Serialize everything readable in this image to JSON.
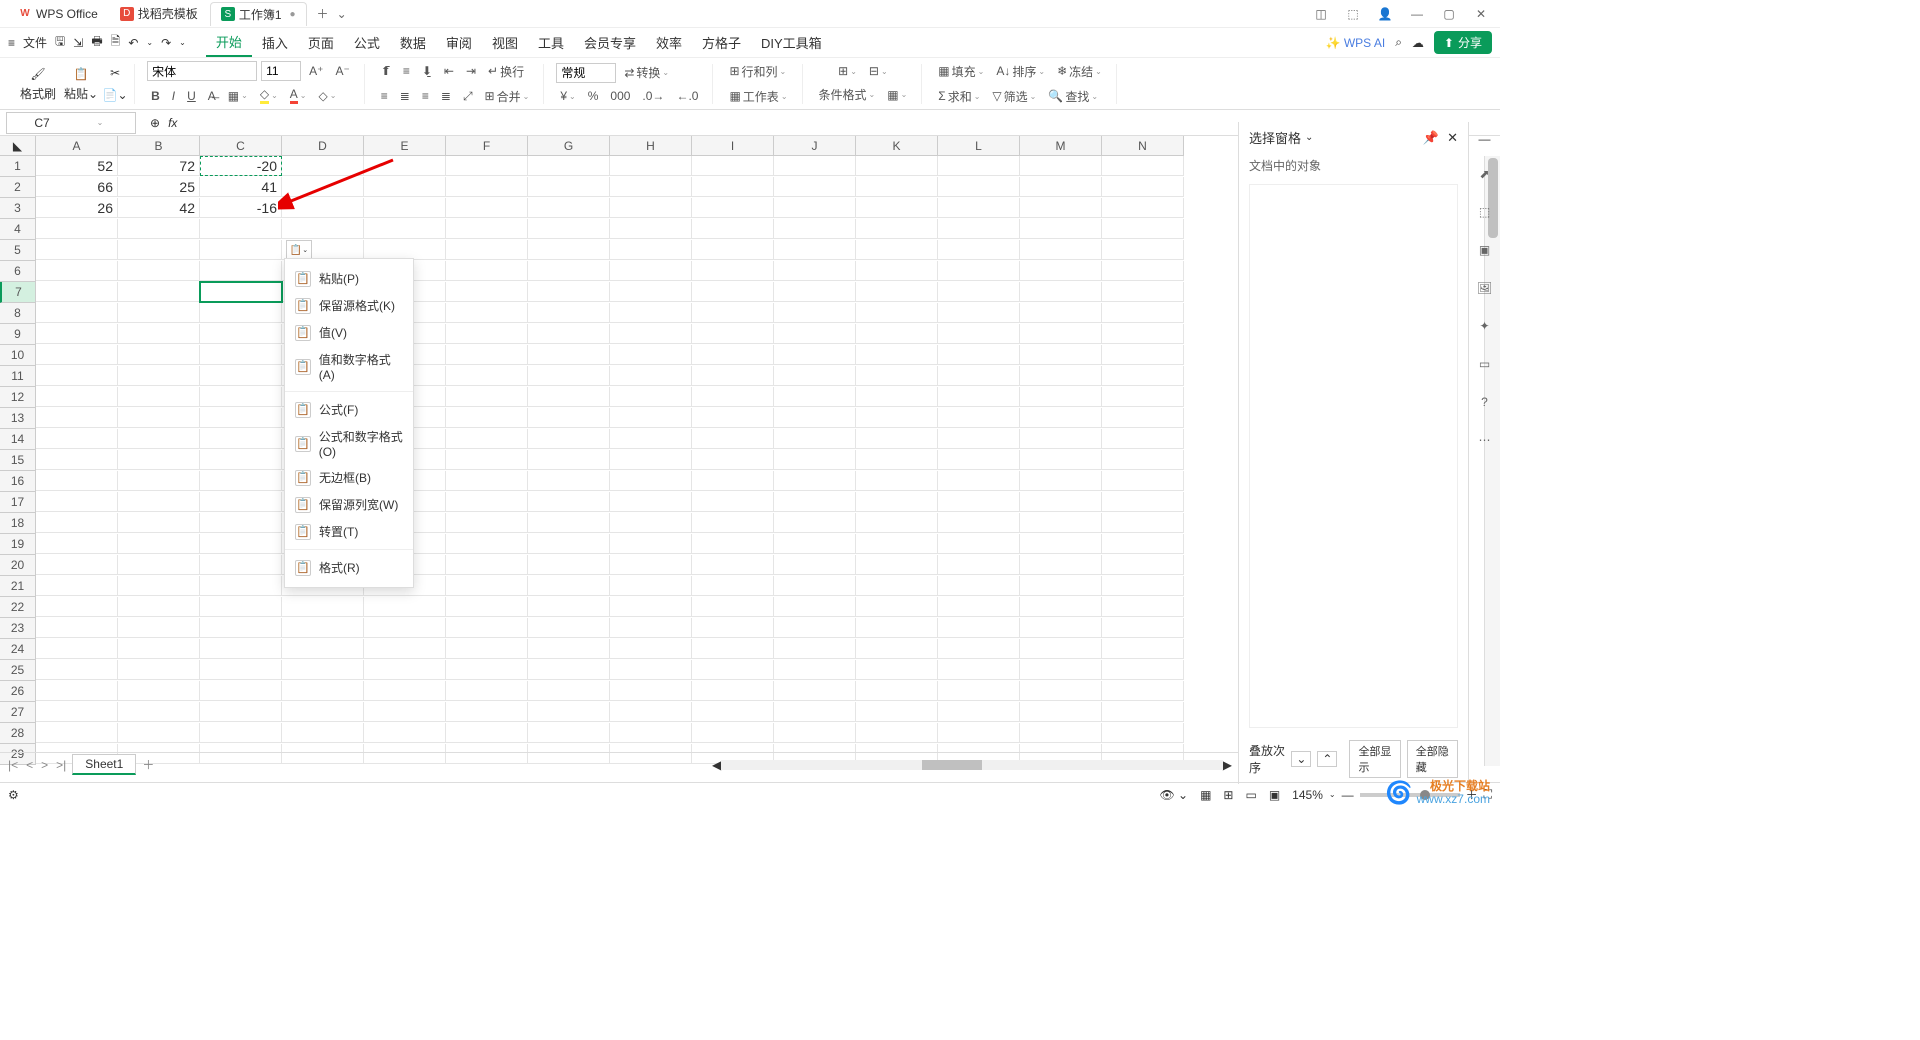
{
  "titlebar": {
    "tabs": [
      {
        "icon_color": "#e74c3c",
        "icon_text": "W",
        "label": "WPS Office"
      },
      {
        "icon_color": "#e74c3c",
        "icon_text": "D",
        "label": "找稻壳模板"
      },
      {
        "icon_color": "#0a9b5a",
        "icon_text": "S",
        "label": "工作簿1",
        "active": true,
        "dirty": "●"
      }
    ],
    "add": "＋",
    "dropdown": "⌄"
  },
  "menubar": {
    "menu": "≡",
    "file": "文件",
    "quick": [
      "save-icon",
      "print-icon",
      "print-preview-icon",
      "print-direct-icon",
      "undo-icon",
      "redo-icon",
      "dropdown-icon"
    ],
    "tabs": [
      "开始",
      "插入",
      "页面",
      "公式",
      "数据",
      "审阅",
      "视图",
      "工具",
      "会员专享",
      "效率",
      "方格子",
      "DIY工具箱"
    ],
    "active_tab": "开始",
    "ai": "WPS AI",
    "search": "⌕",
    "cloud": "☁",
    "share": "分享"
  },
  "ribbon": {
    "format_painter": "格式刷",
    "paste": "粘贴",
    "font": "宋体",
    "size": "11",
    "number_format": "常规",
    "convert": "转换",
    "row_col": "行和列",
    "worksheet": "工作表",
    "cond_format": "条件格式",
    "fill": "填充",
    "sort": "排序",
    "freeze": "冻结",
    "sum": "求和",
    "filter": "筛选",
    "find": "查找",
    "wrap": "换行",
    "merge": "合并"
  },
  "namebox": {
    "cell": "C7",
    "fx": "fx"
  },
  "grid": {
    "columns": [
      "A",
      "B",
      "C",
      "D",
      "E",
      "F",
      "G",
      "H",
      "I",
      "J",
      "K",
      "L",
      "M",
      "N"
    ],
    "row_count": 29,
    "data": {
      "1": {
        "A": "52",
        "B": "72",
        "C": "-20"
      },
      "2": {
        "A": "66",
        "B": "25",
        "C": "41"
      },
      "3": {
        "A": "26",
        "B": "42",
        "C": "-16"
      }
    },
    "copied_cell": "C1",
    "selected_cell": "C7"
  },
  "paste_menu": {
    "items": [
      {
        "label": "粘贴(P)"
      },
      {
        "label": "保留源格式(K)"
      },
      {
        "label": "值(V)"
      },
      {
        "label": "值和数字格式(A)"
      },
      {
        "sep": true
      },
      {
        "label": "公式(F)"
      },
      {
        "label": "公式和数字格式(O)"
      },
      {
        "label": "无边框(B)"
      },
      {
        "label": "保留源列宽(W)"
      },
      {
        "label": "转置(T)"
      },
      {
        "sep": true
      },
      {
        "label": "格式(R)"
      }
    ]
  },
  "rightpanel": {
    "title": "选择窗格",
    "sub": "文档中的对象",
    "stack": "叠放次序",
    "show_all": "全部显示",
    "hide_all": "全部隐藏"
  },
  "sheets": {
    "active": "Sheet1"
  },
  "statusbar": {
    "zoom": "145%"
  },
  "watermark": {
    "brand": "极光下载站",
    "url": "www.xz7.com"
  }
}
